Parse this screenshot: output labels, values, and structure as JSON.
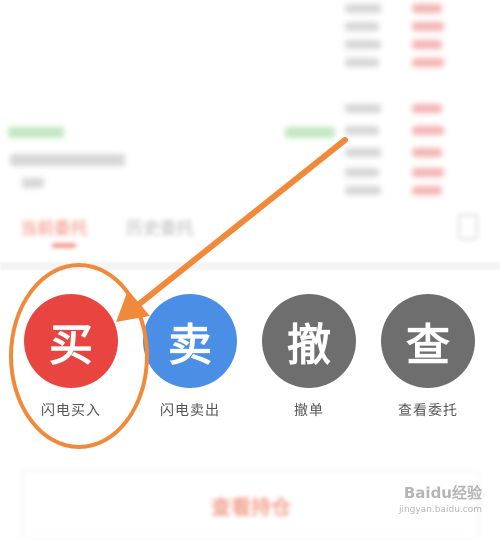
{
  "tabs": {
    "active": "当前委托",
    "other": "历史委托"
  },
  "actions": [
    {
      "glyph": "买",
      "label": "闪电买入",
      "color": "#e84540"
    },
    {
      "glyph": "卖",
      "label": "闪电卖出",
      "color": "#4a8ee6"
    },
    {
      "glyph": "撤",
      "label": "撤单",
      "color": "#6e6e6e"
    },
    {
      "glyph": "查",
      "label": "查看委托",
      "color": "#6e6e6e"
    }
  ],
  "bottom_button": "查看持仓",
  "watermark": {
    "brand": "Baidu经验",
    "url": "jingyan.baidu.com"
  },
  "annotation_color": "#f08a3a"
}
